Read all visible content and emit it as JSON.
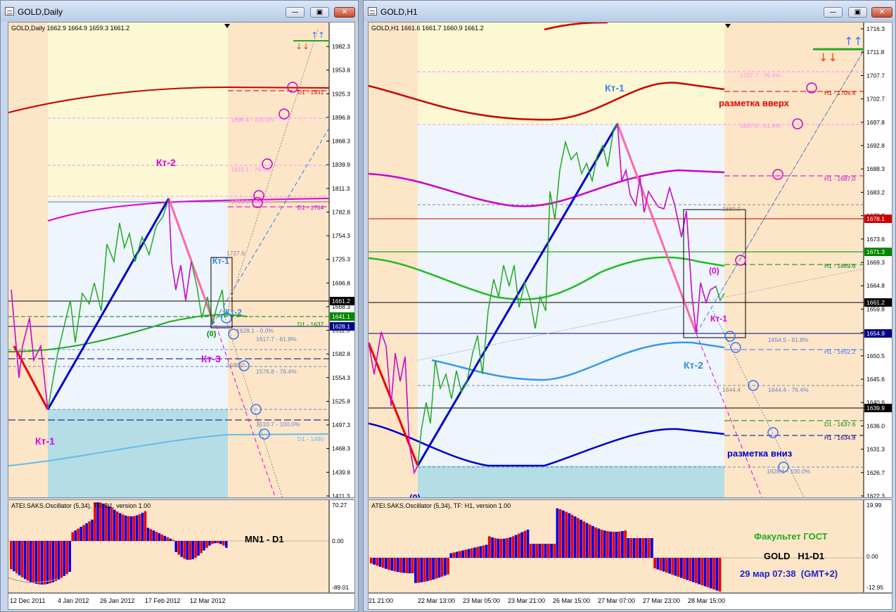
{
  "left_window": {
    "title": "GOLD,Daily",
    "chart_header": "GOLD,Daily  1662.9 1664.9 1659.3 1661.2",
    "price_ticks": [
      "1982.3",
      "1953.8",
      "1925.3",
      "1896.8",
      "1868.3",
      "1839.9",
      "1811.3",
      "1782.8",
      "1754.3",
      "1725.3",
      "1696.8",
      "1668.3",
      "1611.3",
      "1582.8",
      "1554.3",
      "1525.8",
      "1497.3",
      "1468.3",
      "1439.8",
      "1411.3"
    ],
    "price_tags": [
      {
        "text": "1661.2",
        "bg": "#000000",
        "fg": "#ffffff"
      },
      {
        "text": "1641.1",
        "bg": "#008800",
        "fg": "#ffffff"
      },
      {
        "text": "1628.1",
        "bg": "#000088",
        "fg": "#ffffff"
      }
    ],
    "date_ticks": [
      "12 Dec 2011",
      "4 Jan 2012",
      "26 Jan 2012",
      "17 Feb 2012",
      "12 Mar 2012"
    ],
    "osc_header": "ATEI.SAKS.Oscillator (5,34), TF: D1, version 1.00",
    "osc_ticks": [
      "70.27",
      "0.00",
      "-89.01"
    ],
    "tf_label": "MN1 - D1",
    "labels": {
      "kt2": "Кт-2",
      "kt1": "Кт-1",
      "kt3": "Кт-3",
      "kt1_blue": "Кт-1",
      "kt2_blue": "Кт-2",
      "zero": "(0)",
      "d1_1931": "D1 - 1931",
      "d1_1784": "D1 - 1784",
      "d1_1637": "D1 - 1637",
      "d1_1490": "D1 - 1490",
      "f1896": "1896.4 - 100.0%",
      "f1833": "1833.1 - 76.4%",
      "f1794": "1794.0 - 61.8%",
      "p1727": "1727.6",
      "f1628": "1628.1 - 0.0%",
      "f1617": "1617.7 - 61.8%",
      "p1585": "1585.0",
      "f1576": "1576.8 - 76.4%",
      "f1510": "1510.7 - 100.0%"
    }
  },
  "right_window": {
    "title": "GOLD,H1",
    "chart_header": "GOLD,H1  1661.6 1661.7 1660.9 1661.2",
    "price_ticks": [
      "1716.3",
      "1711.8",
      "1707.7",
      "1702.7",
      "1697.8",
      "1692.8",
      "1688.3",
      "1683.2",
      "1678.3",
      "1673.6",
      "1669.3",
      "1664.8",
      "1659.8",
      "1655.1",
      "1650.5",
      "1645.6",
      "1640.6",
      "1636.0",
      "1631.3",
      "1626.7",
      "1622.3"
    ],
    "price_tags": [
      {
        "text": "1678.1",
        "bg": "#cc0000",
        "fg": "#ffffff"
      },
      {
        "text": "1671.3",
        "bg": "#008800",
        "fg": "#ffffff"
      },
      {
        "text": "1661.2",
        "bg": "#000000",
        "fg": "#ffffff"
      },
      {
        "text": "1654.9",
        "bg": "#000088",
        "fg": "#ffffff"
      },
      {
        "text": "1639.9",
        "bg": "#000000",
        "fg": "#ffffff"
      }
    ],
    "date_ticks": [
      "21 21:00",
      "22 Mar 13:00",
      "23 Mar 05:00",
      "23 Mar 21:00",
      "26 Mar 15:00",
      "27 Mar 07:00",
      "27 Mar 23:00",
      "28 Mar 15:00"
    ],
    "osc_header": "ATEI.SAKS.Oscillator (5,34), TF: H1, version 1.00",
    "osc_ticks": [
      "19.99",
      "0.00",
      "-12.95"
    ],
    "labels": {
      "kt1": "Кт-1",
      "kt2": "Кт-2",
      "kt1_small": "Кт-1",
      "zero_top": "(0)",
      "zero_bottom": "(0)",
      "up": "разметка вверх",
      "down": "разметка вниз",
      "h1_1704": "H1 - 1704.4",
      "h1_1687": "H1 - 1687.0",
      "h1_1669": "H1 - 1669.6",
      "h1_1652": "H1 - 1652.2",
      "h1_1634": "H1 - 1634.8",
      "d1_1637": "D1 - 1637.6",
      "f1707": "1707.7 - 76.4%",
      "f1697": "1697.6 - 61.8%",
      "p1680": "1680.9",
      "f1654": "1654.5 - 61.8%",
      "p1644": "1644.4",
      "f1644": "1644.4 - 76.4%",
      "f1628": "1628.1 - 100.0%"
    },
    "info": {
      "school": "Факультет ГОСТ",
      "pair": "GOLD   H1-D1",
      "date": "29 мар 07:38  (GMT+2)"
    }
  },
  "colors": {
    "bull": "#008800",
    "bear": "#dd00dd",
    "trend_up": "#0000cc",
    "trend_down": "#ff66aa",
    "osc_up": "#ee0000",
    "osc_down": "#0000ee"
  }
}
